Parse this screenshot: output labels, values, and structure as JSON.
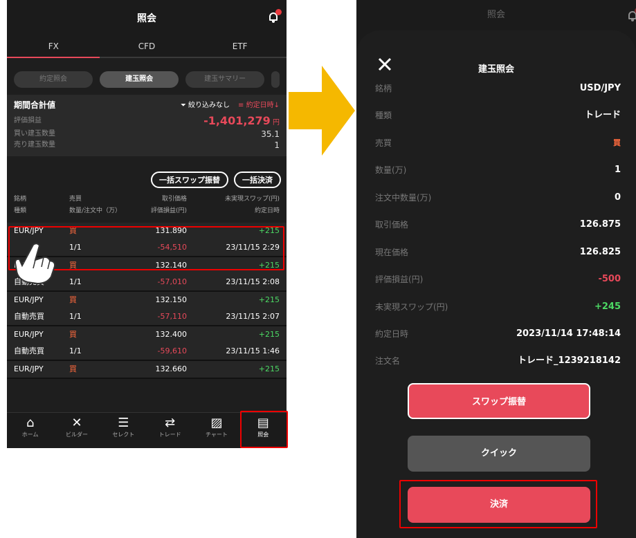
{
  "left": {
    "title": "照会",
    "tabs": [
      "FX",
      "CFD",
      "ETF"
    ],
    "segments": [
      "約定照会",
      "建玉照会",
      "建玉サマリー"
    ],
    "summary": {
      "heading": "期間合計値",
      "filter_label": "絞り込みなし",
      "sort_label": "約定日時↓",
      "rows": [
        {
          "label": "評価損益",
          "value": "-1,401,279",
          "unit": "円"
        },
        {
          "label": "買い建玉数量",
          "value": "35.1"
        },
        {
          "label": "売り建玉数量",
          "value": "1"
        }
      ]
    },
    "bulk_swap_label": "一括スワップ振替",
    "bulk_settle_label": "一括決済",
    "headers": {
      "row1": [
        "銘柄",
        "売買",
        "取引価格",
        "未実現スワップ(円)"
      ],
      "row2": [
        "種類",
        "数量/注文中（万）",
        "評価損益(円)",
        "約定日時"
      ]
    },
    "positions": [
      {
        "symbol": "EUR/JPY",
        "side": "買",
        "price": "131.890",
        "swap": "+215",
        "type": "",
        "qty": "1/1",
        "pl": "-54,510",
        "date": "23/11/15 2:29"
      },
      {
        "symbol": "EUR/JPY",
        "side": "買",
        "price": "132.140",
        "swap": "+215",
        "type": "自動売買",
        "qty": "1/1",
        "pl": "-57,010",
        "date": "23/11/15 2:08"
      },
      {
        "symbol": "EUR/JPY",
        "side": "買",
        "price": "132.150",
        "swap": "+215",
        "type": "自動売買",
        "qty": "1/1",
        "pl": "-57,110",
        "date": "23/11/15 2:07"
      },
      {
        "symbol": "EUR/JPY",
        "side": "買",
        "price": "132.400",
        "swap": "+215",
        "type": "自動売買",
        "qty": "1/1",
        "pl": "-59,610",
        "date": "23/11/15 1:46"
      },
      {
        "symbol": "EUR/JPY",
        "side": "買",
        "price": "132.660",
        "swap": "+215"
      }
    ],
    "nav": [
      {
        "icon": "home-icon",
        "label": "ホーム"
      },
      {
        "icon": "tools-icon",
        "label": "ビルダー"
      },
      {
        "icon": "select-icon",
        "label": "セレクト"
      },
      {
        "icon": "trade-icon",
        "label": "トレード"
      },
      {
        "icon": "chart-icon",
        "label": "チャート"
      },
      {
        "icon": "inquiry-icon",
        "label": "照会"
      }
    ]
  },
  "right": {
    "title": "照会",
    "sheet_title": "建玉照会",
    "details": [
      {
        "key": "銘柄",
        "value": "USD/JPY"
      },
      {
        "key": "種類",
        "value": "トレード"
      },
      {
        "key": "売買",
        "value": "買"
      },
      {
        "key": "数量(万)",
        "value": "1"
      },
      {
        "key": "注文中数量(万)",
        "value": "0"
      },
      {
        "key": "取引価格",
        "value": "126.875"
      },
      {
        "key": "現在価格",
        "value": "126.825"
      },
      {
        "key": "評価損益(円)",
        "value": "-500"
      },
      {
        "key": "未実現スワップ(円)",
        "value": "+245"
      },
      {
        "key": "約定日時",
        "value": "2023/11/14 17:48:14"
      },
      {
        "key": "注文名",
        "value": "トレード_1239218142"
      }
    ],
    "swap_button": "スワップ振替",
    "quick_button": "クイック",
    "settle_button": "決済"
  },
  "colors": {
    "accent": "#e8495a",
    "buy": "#ff6a3d",
    "positive": "#4cd964",
    "highlight": "#e00000",
    "arrow": "#f5b800"
  }
}
